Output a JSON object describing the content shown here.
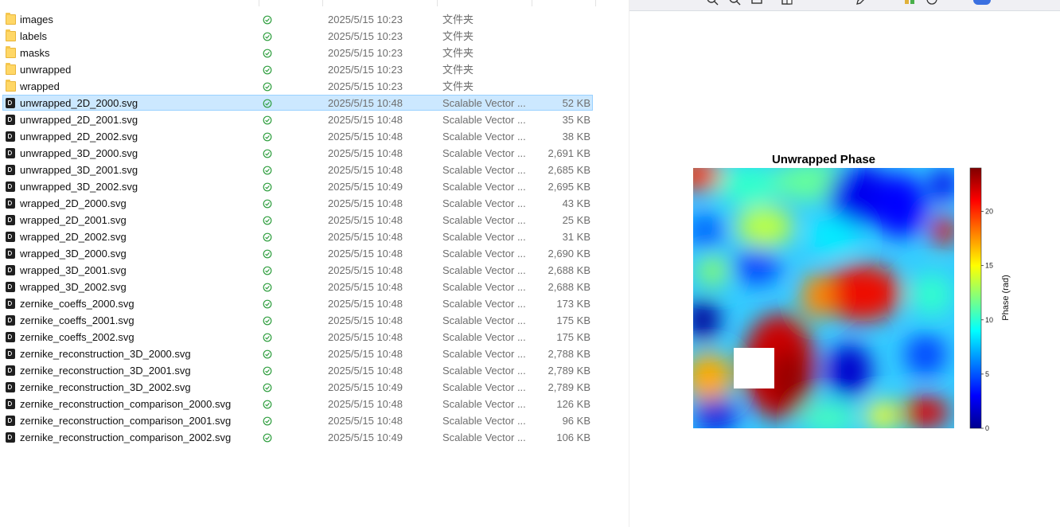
{
  "files": [
    {
      "name": "images",
      "kind": "folder",
      "date": "2025/5/15 10:23",
      "type": "文件夹",
      "size": ""
    },
    {
      "name": "labels",
      "kind": "folder",
      "date": "2025/5/15 10:23",
      "type": "文件夹",
      "size": ""
    },
    {
      "name": "masks",
      "kind": "folder",
      "date": "2025/5/15 10:23",
      "type": "文件夹",
      "size": ""
    },
    {
      "name": "unwrapped",
      "kind": "folder",
      "date": "2025/5/15 10:23",
      "type": "文件夹",
      "size": ""
    },
    {
      "name": "wrapped",
      "kind": "folder",
      "date": "2025/5/15 10:23",
      "type": "文件夹",
      "size": ""
    },
    {
      "name": "unwrapped_2D_2000.svg",
      "kind": "svg",
      "date": "2025/5/15 10:48",
      "type": "Scalable Vector ...",
      "size": "52 KB",
      "selected": true
    },
    {
      "name": "unwrapped_2D_2001.svg",
      "kind": "svg",
      "date": "2025/5/15 10:48",
      "type": "Scalable Vector ...",
      "size": "35 KB"
    },
    {
      "name": "unwrapped_2D_2002.svg",
      "kind": "svg",
      "date": "2025/5/15 10:48",
      "type": "Scalable Vector ...",
      "size": "38 KB"
    },
    {
      "name": "unwrapped_3D_2000.svg",
      "kind": "svg",
      "date": "2025/5/15 10:48",
      "type": "Scalable Vector ...",
      "size": "2,691 KB"
    },
    {
      "name": "unwrapped_3D_2001.svg",
      "kind": "svg",
      "date": "2025/5/15 10:48",
      "type": "Scalable Vector ...",
      "size": "2,685 KB"
    },
    {
      "name": "unwrapped_3D_2002.svg",
      "kind": "svg",
      "date": "2025/5/15 10:49",
      "type": "Scalable Vector ...",
      "size": "2,695 KB"
    },
    {
      "name": "wrapped_2D_2000.svg",
      "kind": "svg",
      "date": "2025/5/15 10:48",
      "type": "Scalable Vector ...",
      "size": "43 KB"
    },
    {
      "name": "wrapped_2D_2001.svg",
      "kind": "svg",
      "date": "2025/5/15 10:48",
      "type": "Scalable Vector ...",
      "size": "25 KB"
    },
    {
      "name": "wrapped_2D_2002.svg",
      "kind": "svg",
      "date": "2025/5/15 10:48",
      "type": "Scalable Vector ...",
      "size": "31 KB"
    },
    {
      "name": "wrapped_3D_2000.svg",
      "kind": "svg",
      "date": "2025/5/15 10:48",
      "type": "Scalable Vector ...",
      "size": "2,690 KB"
    },
    {
      "name": "wrapped_3D_2001.svg",
      "kind": "svg",
      "date": "2025/5/15 10:48",
      "type": "Scalable Vector ...",
      "size": "2,688 KB"
    },
    {
      "name": "wrapped_3D_2002.svg",
      "kind": "svg",
      "date": "2025/5/15 10:48",
      "type": "Scalable Vector ...",
      "size": "2,688 KB"
    },
    {
      "name": "zernike_coeffs_2000.svg",
      "kind": "svg",
      "date": "2025/5/15 10:48",
      "type": "Scalable Vector ...",
      "size": "173 KB"
    },
    {
      "name": "zernike_coeffs_2001.svg",
      "kind": "svg",
      "date": "2025/5/15 10:48",
      "type": "Scalable Vector ...",
      "size": "175 KB"
    },
    {
      "name": "zernike_coeffs_2002.svg",
      "kind": "svg",
      "date": "2025/5/15 10:48",
      "type": "Scalable Vector ...",
      "size": "175 KB"
    },
    {
      "name": "zernike_reconstruction_3D_2000.svg",
      "kind": "svg",
      "date": "2025/5/15 10:48",
      "type": "Scalable Vector ...",
      "size": "2,788 KB"
    },
    {
      "name": "zernike_reconstruction_3D_2001.svg",
      "kind": "svg",
      "date": "2025/5/15 10:48",
      "type": "Scalable Vector ...",
      "size": "2,789 KB"
    },
    {
      "name": "zernike_reconstruction_3D_2002.svg",
      "kind": "svg",
      "date": "2025/5/15 10:49",
      "type": "Scalable Vector ...",
      "size": "2,789 KB"
    },
    {
      "name": "zernike_reconstruction_comparison_2000.svg",
      "kind": "svg",
      "date": "2025/5/15 10:48",
      "type": "Scalable Vector ...",
      "size": "126 KB"
    },
    {
      "name": "zernike_reconstruction_comparison_2001.svg",
      "kind": "svg",
      "date": "2025/5/15 10:48",
      "type": "Scalable Vector ...",
      "size": "96 KB"
    },
    {
      "name": "zernike_reconstruction_comparison_2002.svg",
      "kind": "svg",
      "date": "2025/5/15 10:49",
      "type": "Scalable Vector ...",
      "size": "106 KB"
    }
  ],
  "viewer": {
    "toolbar": {
      "icons": [
        "zoom-in-icon",
        "zoom-out-icon",
        "print-icon",
        "open-with-icon",
        "edit-icon",
        "apps-icon",
        "info-icon",
        "toggle-switch-icon"
      ],
      "accent": "#3a6fe0"
    }
  },
  "chart_data": {
    "type": "heatmap",
    "title": "Unwrapped Phase",
    "colorbar": {
      "label": "Phase (rad)",
      "ticks": [
        0,
        5,
        10,
        15,
        20
      ],
      "range": [
        0,
        24
      ],
      "colormap": "jet"
    }
  }
}
